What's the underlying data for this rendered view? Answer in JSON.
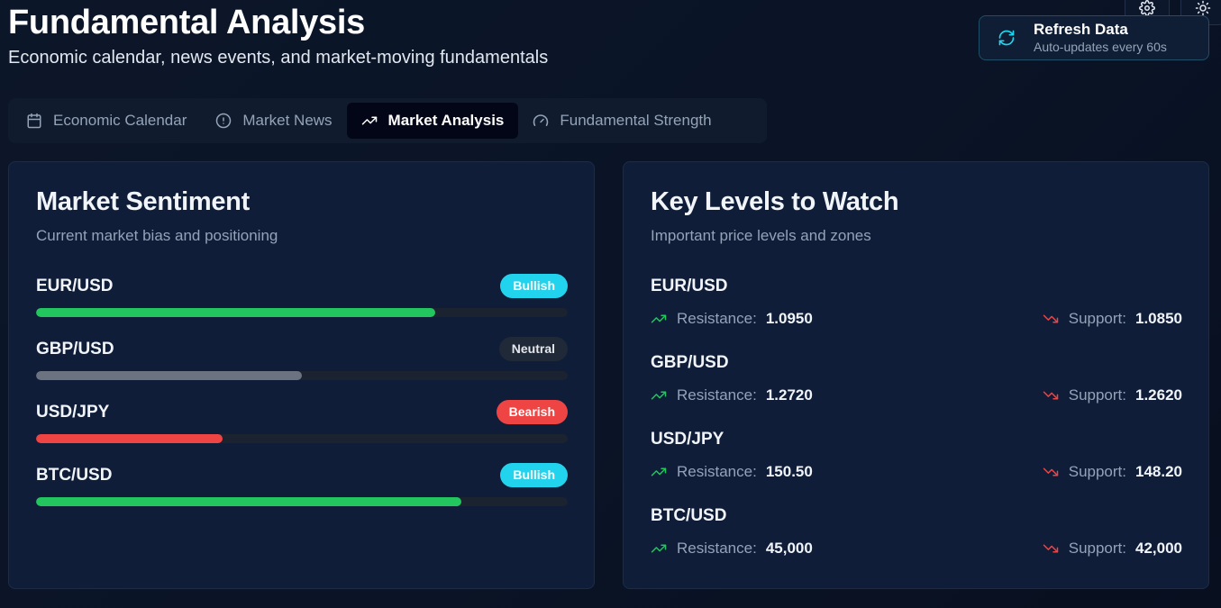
{
  "header": {
    "title": "Fundamental Analysis",
    "subtitle": "Economic calendar, news events, and market-moving fundamentals"
  },
  "top_controls": {
    "settings_icon": "gear-icon",
    "theme_icon": "sun-icon",
    "refresh": {
      "icon": "refresh-icon",
      "title": "Refresh Data",
      "subtitle": "Auto-updates every 60s"
    }
  },
  "tabs": [
    {
      "label": "Economic Calendar",
      "icon": "calendar-icon",
      "active": false
    },
    {
      "label": "Market News",
      "icon": "alert-circle-icon",
      "active": false
    },
    {
      "label": "Market Analysis",
      "icon": "trending-up-icon",
      "active": true
    },
    {
      "label": "Fundamental Strength",
      "icon": "gauge-icon",
      "active": false
    }
  ],
  "sentiment": {
    "title": "Market Sentiment",
    "description": "Current market bias and positioning",
    "items": [
      {
        "pair": "EUR/USD",
        "label": "Bullish",
        "strength": 0.75
      },
      {
        "pair": "GBP/USD",
        "label": "Neutral",
        "strength": 0.5
      },
      {
        "pair": "USD/JPY",
        "label": "Bearish",
        "strength": 0.35
      },
      {
        "pair": "BTC/USD",
        "label": "Bullish",
        "strength": 0.8
      }
    ]
  },
  "levels": {
    "title": "Key Levels to Watch",
    "description": "Important price levels and zones",
    "resistance_label": "Resistance:",
    "support_label": "Support:",
    "items": [
      {
        "pair": "EUR/USD",
        "resistance": "1.0950",
        "support": "1.0850"
      },
      {
        "pair": "GBP/USD",
        "resistance": "1.2720",
        "support": "1.2620"
      },
      {
        "pair": "USD/JPY",
        "resistance": "150.50",
        "support": "148.20"
      },
      {
        "pair": "BTC/USD",
        "resistance": "45,000",
        "support": "42,000"
      }
    ]
  },
  "colors": {
    "bullish": "#22c55e",
    "bullish_badge": "#22d3ee",
    "neutral": "#6b7280",
    "bearish": "#ef4444",
    "accent": "#22d3ee"
  }
}
